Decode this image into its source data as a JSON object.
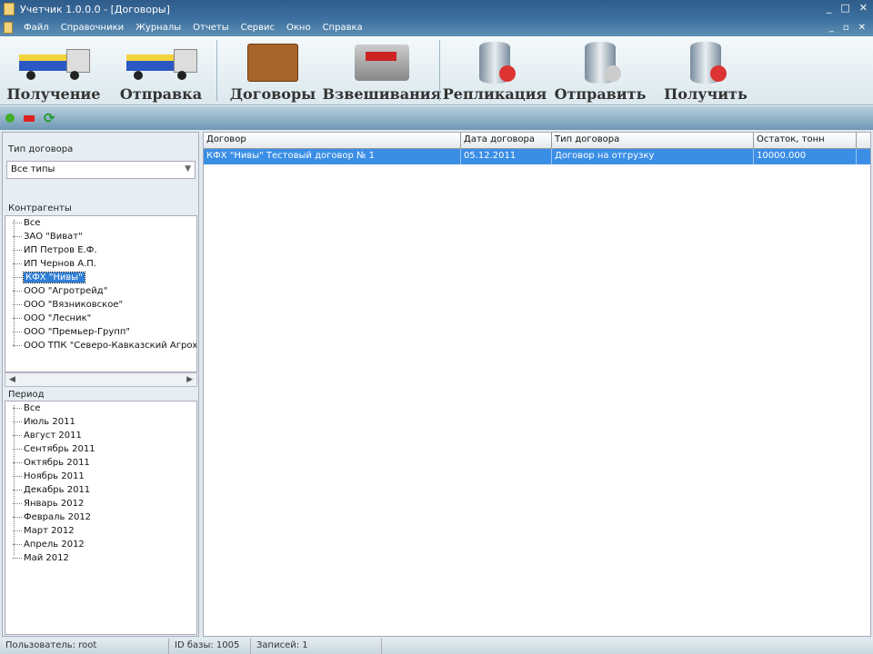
{
  "window": {
    "title": "Учетчик 1.0.0.0 - [Договоры]",
    "controls": [
      "_",
      "□",
      "✕"
    ],
    "mdi_controls": [
      "_",
      "▫",
      "✕"
    ]
  },
  "menu": [
    "Файл",
    "Справочники",
    "Журналы",
    "Отчеты",
    "Сервис",
    "Окно",
    "Справка"
  ],
  "toolbar": [
    "Получение",
    "Отправка",
    "Договоры",
    "Взвешивания",
    "Репликация",
    "Отправить",
    "Получить"
  ],
  "filters": {
    "type_label": "Тип договора",
    "type_value": "Все типы",
    "contractors_label": "Контрагенты",
    "period_label": "Период"
  },
  "contractors": [
    "Все",
    "ЗАО \"Виват\"",
    "ИП Петров Е.Ф.",
    "ИП Чернов А.П.",
    "КФХ \"Нивы\"",
    "ООО \"Агротрейд\"",
    "ООО \"Вязниковское\"",
    "ООО \"Лесник\"",
    "ООО \"Премьер-Групп\"",
    "ООО ТПК \"Северо-Кавказский Агрохим\""
  ],
  "periods": [
    "Все",
    "Июль 2011",
    "Август 2011",
    "Сентябрь 2011",
    "Октябрь 2011",
    "Ноябрь 2011",
    "Декабрь 2011",
    "Январь 2012",
    "Февраль 2012",
    "Март 2012",
    "Апрель 2012",
    "Май 2012"
  ],
  "table": {
    "columns": [
      "Договор",
      "Дата договора",
      "Тип договора",
      "Остаток, тонн"
    ],
    "rows": [
      [
        "КФХ \"Нивы\" Тестовый договор № 1",
        "05.12.2011",
        "Договор на отгрузку",
        "10000.000"
      ]
    ]
  },
  "status": {
    "user": "Пользователь: root",
    "db": "ID базы: 1005",
    "records": "Записей: 1"
  }
}
